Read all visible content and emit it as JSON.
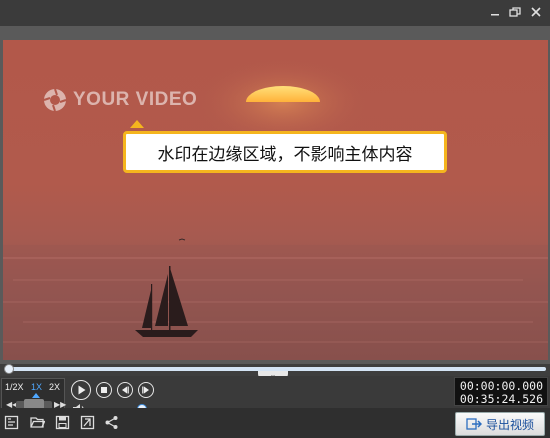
{
  "window": {
    "minimize_icon": "minimize-icon",
    "restore_icon": "restore-icon"
  },
  "video": {
    "watermark_text": "YOUR VIDEO",
    "callout_text": "水印在边缘区域，不影响主体内容",
    "callout_border_color": "#f5b51e"
  },
  "player": {
    "speed_options": [
      "1/2X",
      "1X",
      "2X"
    ],
    "speed_selected": "1X",
    "progress_fraction": 0.0,
    "volume_fraction": 0.93,
    "current_time": "00:00:00.000",
    "total_time": "00:35:24.526",
    "accent_color": "#3d8ee0"
  },
  "toolbar": {
    "icons": [
      "video-settings-icon",
      "open-folder-icon",
      "save-icon",
      "export-file-icon",
      "share-icon"
    ],
    "export_label": "导出视频"
  }
}
